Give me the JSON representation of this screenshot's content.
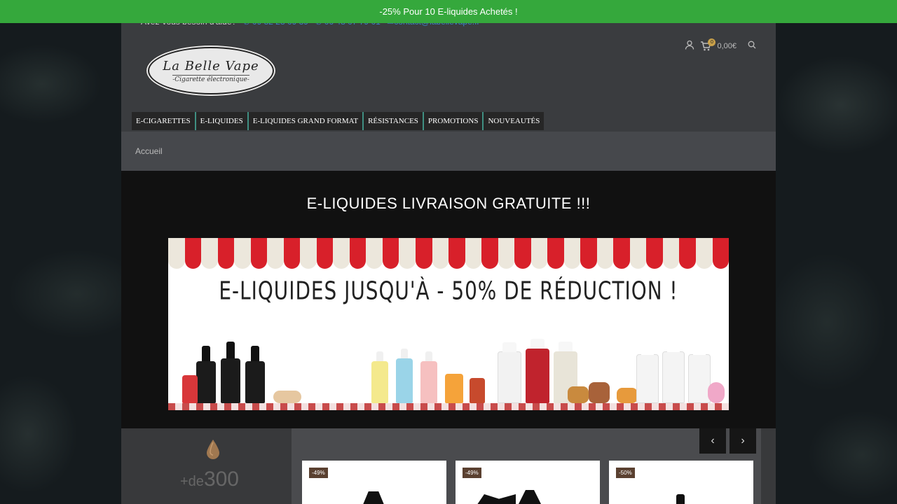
{
  "promo": {
    "text": "-25% Pour 10 E-liquides Achetés !"
  },
  "topinfo": {
    "help": "Avez-vous besoin d'aide?",
    "phone1": "✆ 09 82 28 09 39",
    "phone2": "✆ 06 48 07 79 01",
    "email": "✉contact@labellevape.fr"
  },
  "logo": {
    "name": "La Belle Vape",
    "tagline": "-Cigarette électronique-"
  },
  "header": {
    "cart_count": "0",
    "cart_total": "0,00€"
  },
  "nav": {
    "items": [
      "E-CIGARETTES",
      "E-LIQUIDES",
      "E-LIQUIDES GRAND FORMAT",
      "RÉSISTANCES",
      "PROMOTIONS",
      "NOUVEAUTÉS"
    ]
  },
  "breadcrumb": {
    "home": "Accueil"
  },
  "hero": {
    "title": "E-LIQUIDES LIVRAISON GRATUITE !!!",
    "banner_text": "E-LIQUIDES JUSQU'À - 50% DE RÉDUCTION !"
  },
  "stats": {
    "prefix": "+de",
    "value": "300"
  },
  "carousel": {
    "prev": "‹",
    "next": "›"
  },
  "products": [
    {
      "badge": "-49%"
    },
    {
      "badge": "-49%"
    },
    {
      "badge": "-50%"
    }
  ],
  "colors": {
    "promo_green": "#35a83c",
    "nav_accent": "#3f8f82",
    "badge": "#5a4030"
  }
}
